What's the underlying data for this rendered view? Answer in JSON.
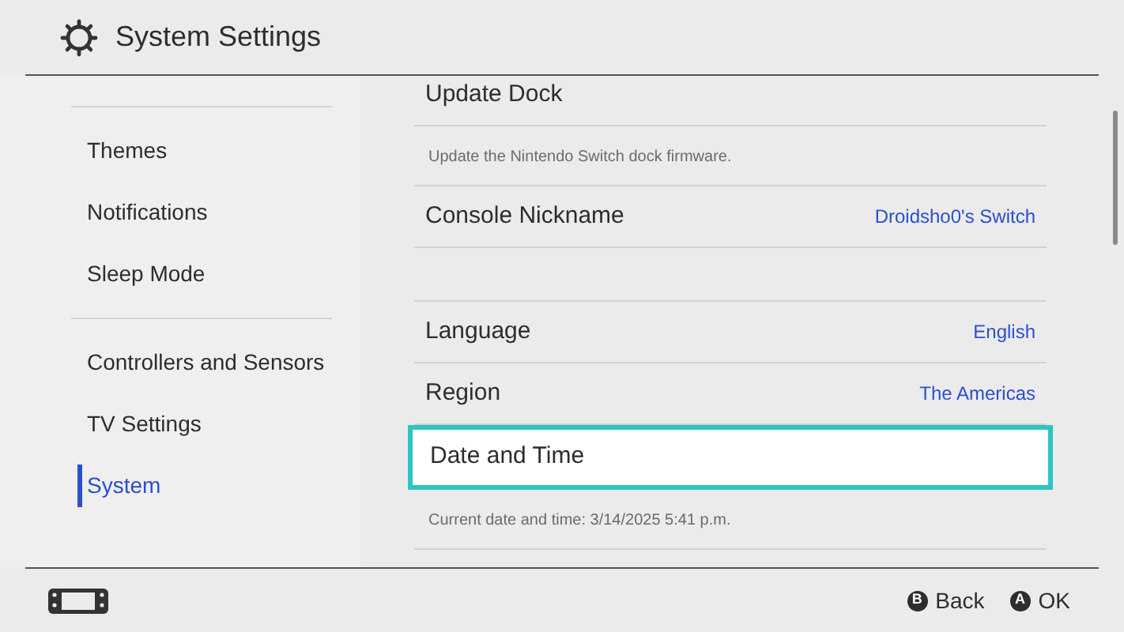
{
  "header": {
    "title": "System Settings"
  },
  "sidebar": {
    "groups": [
      [
        {
          "label": "Themes",
          "selected": false
        },
        {
          "label": "Notifications",
          "selected": false
        },
        {
          "label": "Sleep Mode",
          "selected": false
        }
      ],
      [
        {
          "label": "Controllers and Sensors",
          "selected": false
        },
        {
          "label": "TV Settings",
          "selected": false
        },
        {
          "label": "System",
          "selected": true
        }
      ]
    ]
  },
  "content": {
    "groups": [
      [
        {
          "label": "Update Dock",
          "description": "Update the Nintendo Switch dock firmware.",
          "selected": false
        },
        {
          "label": "Console Nickname",
          "value": "Droidsho0's Switch",
          "selected": false
        }
      ],
      [
        {
          "label": "Language",
          "value": "English",
          "selected": false
        },
        {
          "label": "Region",
          "value": "The Americas",
          "selected": false
        },
        {
          "label": "Date and Time",
          "description": "Current date and time: 3/14/2025 5:41 p.m.",
          "selected": true
        }
      ]
    ]
  },
  "footer": {
    "buttons": [
      {
        "glyph": "B",
        "label": "Back"
      },
      {
        "glyph": "A",
        "label": "OK"
      }
    ]
  }
}
